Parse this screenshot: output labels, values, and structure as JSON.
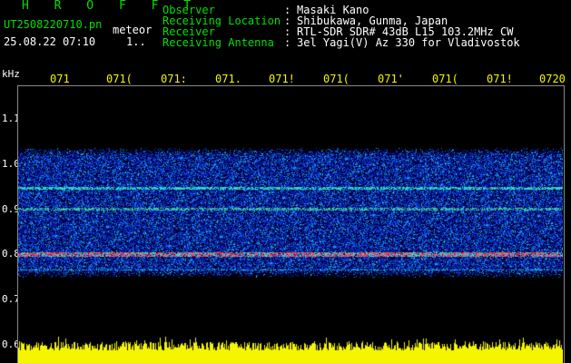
{
  "title": "H R O F F T",
  "file": {
    "name": "UT2508220710.pn",
    "suffix": "meteor",
    "datetime": "25.08.22 07:10",
    "counter": "1.."
  },
  "header": [
    {
      "label": "Observer",
      "value": "Masaki Kano"
    },
    {
      "label": "Receiving Location",
      "value": "Shibukawa, Gunma, Japan"
    },
    {
      "label": "Receiver",
      "value": "RTL-SDR SDR# 43dB L15 103.2MHz CW"
    },
    {
      "label": "Receiving Antenna",
      "value": "3el Yagi(V) Az 330 for Vladivostok"
    }
  ],
  "header_sep": ":",
  "y_axis": {
    "unit": "kHz",
    "ticks": [
      "1.1",
      "1.0",
      "0.9",
      "0.8",
      "0.7",
      "0.6"
    ]
  },
  "time_ticks": [
    "071",
    "071(",
    "071:",
    "071.",
    "071!",
    "071(",
    "071'",
    "071(",
    "071!",
    "0720"
  ],
  "colors": {
    "header_label": "#00e000",
    "header_value": "#ffffff",
    "time_ticks": "#f5f500",
    "band_bright": "#ff3050",
    "noise_blue": "#1a5cff",
    "noise_cyan": "#20d0d0",
    "background": "#000000",
    "bottom_band": "#f5f500"
  }
}
